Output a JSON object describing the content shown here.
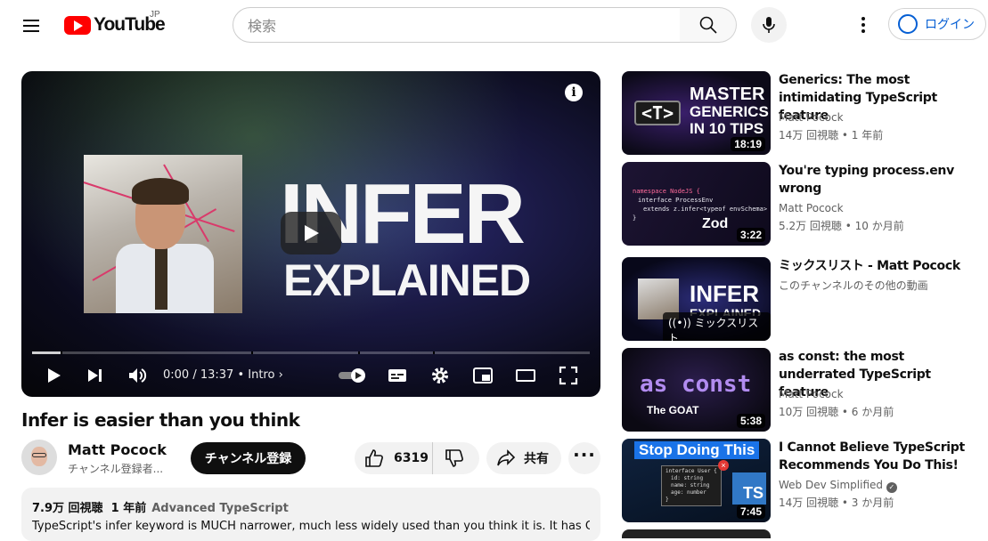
{
  "header": {
    "logo_text": "YouTube",
    "region": "JP",
    "search_placeholder": "検索",
    "login_label": "ログイン"
  },
  "player": {
    "overlay_line1": "INFER",
    "overlay_line2": "EXPLAINED",
    "time": "0:00 / 13:37",
    "chapter": "Intro",
    "info_glyph": "i"
  },
  "video": {
    "title": "Infer is easier than you think",
    "channel": "Matt Pocock",
    "subscribers": "チャンネル登録者...",
    "subscribe_label": "チャンネル登録",
    "likes": "6319",
    "share_label": "共有",
    "views": "7.9万 回視聴",
    "age": "1 年前",
    "tag": "Advanced TypeScript",
    "description": "TypeScript's infer keyword is MUCH narrower, much less widely used than you think it is. It has ONE"
  },
  "sidebar": {
    "items": [
      {
        "title": "Generics: The most intimidating TypeScript feature",
        "channel": "Matt Pocock",
        "meta": "14万 回視聴 • 1 年前",
        "duration": "18:19",
        "thumb_text": [
          "MASTER",
          "GENERICS",
          "IN 10 TIPS"
        ],
        "thumb_badge": "<T>"
      },
      {
        "title": "You're typing process.env wrong",
        "channel": "Matt Pocock",
        "meta": "5.2万 回視聴 • 10 か月前",
        "duration": "3:22",
        "thumb_code": [
          "namespace NodeJS {",
          "interface ProcessEnv",
          "extends z.infer<typeof envSchema>",
          "}"
        ],
        "thumb_text": [
          "Zod"
        ]
      },
      {
        "title": "ミックスリスト - Matt Pocock",
        "channel": "このチャンネルのその他の動画",
        "meta": "",
        "duration": "",
        "thumb_text": [
          "INFER",
          "EXPLAINED"
        ],
        "mix_label": "ミックスリスト"
      },
      {
        "title": "as const: the most underrated TypeScript feature",
        "channel": "Matt Pocock",
        "meta": "10万 回視聴 • 6 か月前",
        "duration": "5:38",
        "thumb_text": [
          "as const",
          "The GOAT"
        ]
      },
      {
        "title": "I Cannot Believe TypeScript Recommends You Do This!",
        "channel": "Web Dev Simplified",
        "meta": "14万 回視聴 • 3 か月前",
        "duration": "7:45",
        "verified": true,
        "thumb_text": [
          "Stop Doing This",
          "TS"
        ],
        "thumb_code": [
          "interface User {",
          "id: string",
          "name: string",
          "age: number",
          "}"
        ]
      }
    ]
  },
  "colors": {
    "brand_red": "#ff0000",
    "link_blue": "#065fd4",
    "text_secondary": "#606060",
    "chip_bg": "#f2f2f2"
  }
}
